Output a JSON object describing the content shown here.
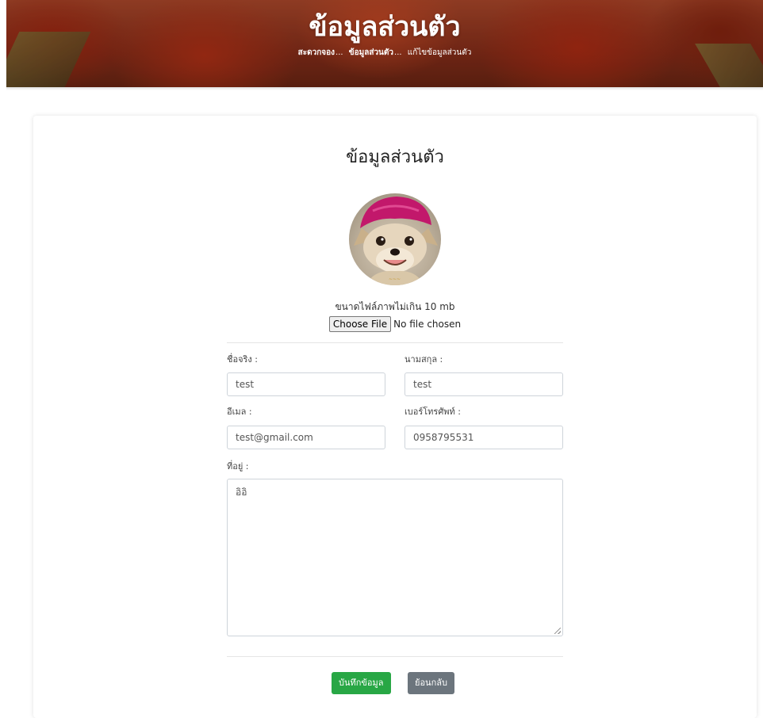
{
  "header": {
    "title": "ข้อมูลส่วนตัว",
    "breadcrumb": [
      {
        "label": "สะดวกจอง",
        "separator": "..."
      },
      {
        "label": "ข้อมูลส่วนตัว",
        "separator": "..."
      },
      {
        "label": "แก้ไขข้อมูลส่วนตัว",
        "separator": ""
      }
    ]
  },
  "profile": {
    "title": "ข้อมูลส่วนตัว",
    "upload_note": "ขนาดไฟล์ภาพไม่เกิน 10 mb",
    "file_button": "Choose File",
    "file_status": "No file chosen"
  },
  "form": {
    "first_name": {
      "label": "ชื่อจริง :",
      "value": "test"
    },
    "last_name": {
      "label": "นามสกุล :",
      "value": "test"
    },
    "email": {
      "label": "อีเมล :",
      "value": "test@gmail.com"
    },
    "phone": {
      "label": "เบอร์โทรศัพท์ :",
      "value": "0958795531"
    },
    "address": {
      "label": "ที่อยู่ :",
      "value": "อิอิ"
    }
  },
  "actions": {
    "save_label": "บันทึกข้อมูล",
    "back_label": "ย้อนกลับ"
  },
  "colors": {
    "save_button": "#28a745",
    "back_button": "#6c757d"
  }
}
